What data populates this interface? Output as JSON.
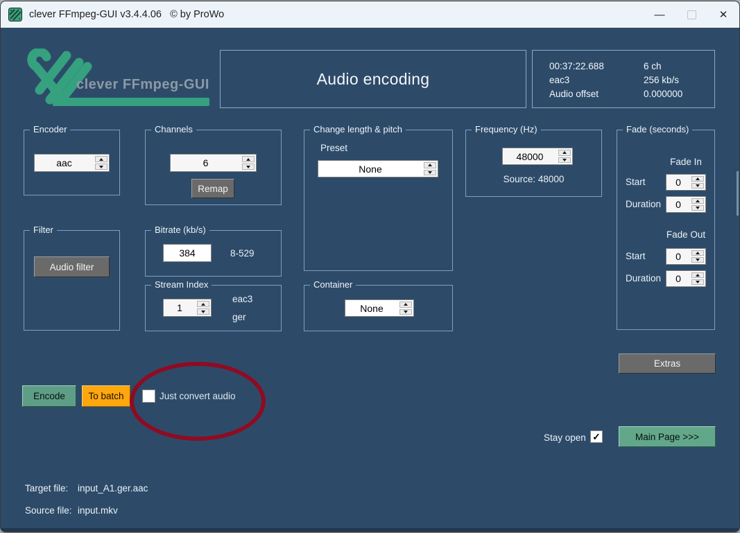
{
  "window": {
    "title": "clever FFmpeg-GUI v3.4.4.06   © by ProWo",
    "minimize_icon": "—",
    "close_icon": "✕"
  },
  "brand": {
    "logo_text": "clever FFmpeg-GUI"
  },
  "header": {
    "title": "Audio encoding"
  },
  "source_info": {
    "rows": [
      [
        "00:37:22.688",
        "6 ch"
      ],
      [
        "eac3",
        "256 kb/s"
      ],
      [
        "Audio offset",
        "0.000000"
      ]
    ]
  },
  "groups": {
    "encoder": {
      "title": "Encoder",
      "value": "aac"
    },
    "channels": {
      "title": "Channels",
      "value": "6",
      "remap": "Remap"
    },
    "length_pitch": {
      "title": "Change length & pitch",
      "preset_label": "Preset",
      "preset_value": "None"
    },
    "frequency": {
      "title": "Frequency (Hz)",
      "value": "48000",
      "source": "Source: 48000"
    },
    "fade": {
      "title": "Fade (seconds)",
      "in_label": "Fade In",
      "out_label": "Fade Out",
      "start_label": "Start",
      "duration_label": "Duration",
      "in_start": "0",
      "in_duration": "0",
      "out_start": "0",
      "out_duration": "0"
    },
    "filter": {
      "title": "Filter",
      "button": "Audio filter"
    },
    "bitrate": {
      "title": "Bitrate (kb/s)",
      "value": "384",
      "range": "8-529"
    },
    "stream": {
      "title": "Stream Index",
      "value": "1",
      "codec": "eac3",
      "language": "ger"
    },
    "container": {
      "title": "Container",
      "value": "None"
    }
  },
  "actions": {
    "encode": "Encode",
    "to_batch": "To batch",
    "just_convert": "Just convert audio",
    "extras": "Extras",
    "stay_open": "Stay open",
    "main_page": "Main Page >>>"
  },
  "files": {
    "target_label": "Target file:",
    "target": "input_A1.ger.aac",
    "source_label": "Source file:",
    "source": "input.mkv"
  },
  "colors": {
    "background": "#2d4b69",
    "titlebar": "#edf4f9",
    "brand_green": "#35a17e",
    "group_border": "#7f9fbf",
    "encode_green": "#5f9e86",
    "main_page_green": "#63a78b",
    "batch_orange": "#ffa70f",
    "gray_button": "#6a6a6a",
    "annotation_red": "#8e0c23"
  }
}
